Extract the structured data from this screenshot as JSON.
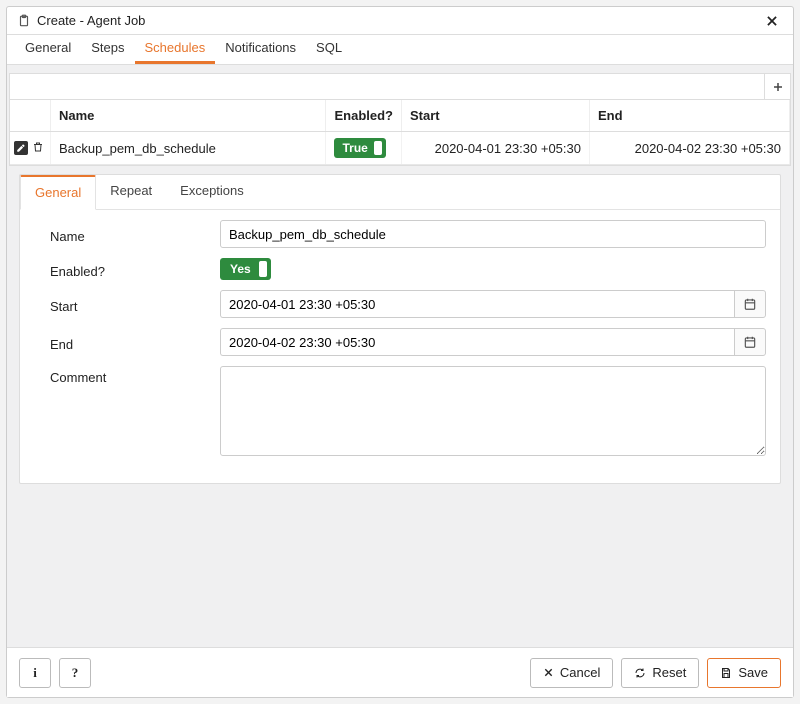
{
  "dialog": {
    "title": "Create - Agent Job"
  },
  "main_tabs": [
    {
      "label": "General"
    },
    {
      "label": "Steps"
    },
    {
      "label": "Schedules"
    },
    {
      "label": "Notifications"
    },
    {
      "label": "SQL"
    }
  ],
  "grid": {
    "headers": {
      "name": "Name",
      "enabled": "Enabled?",
      "start": "Start",
      "end": "End"
    },
    "rows": [
      {
        "name": "Backup_pem_db_schedule",
        "enabled_label": "True",
        "start": "2020-04-01 23:30 +05:30",
        "end": "2020-04-02 23:30 +05:30"
      }
    ]
  },
  "sub_tabs": [
    {
      "label": "General"
    },
    {
      "label": "Repeat"
    },
    {
      "label": "Exceptions"
    }
  ],
  "form": {
    "labels": {
      "name": "Name",
      "enabled": "Enabled?",
      "start": "Start",
      "end": "End",
      "comment": "Comment"
    },
    "values": {
      "name": "Backup_pem_db_schedule",
      "enabled_label": "Yes",
      "start": "2020-04-01 23:30 +05:30",
      "end": "2020-04-02 23:30 +05:30",
      "comment": ""
    }
  },
  "footer": {
    "info": "i",
    "help": "?",
    "cancel": "Cancel",
    "reset": "Reset",
    "save": "Save"
  }
}
